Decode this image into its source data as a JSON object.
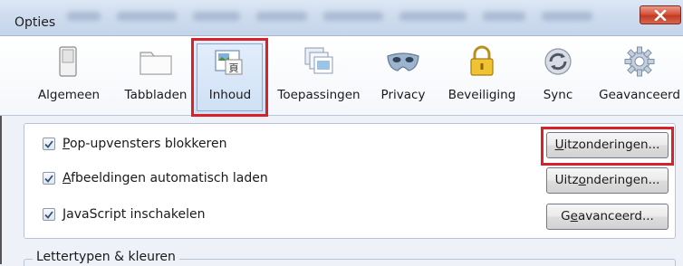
{
  "window": {
    "title": "Opties"
  },
  "tabs": [
    {
      "label": "Algemeen",
      "icon": "switch-icon"
    },
    {
      "label": "Tabbladen",
      "icon": "folder-tabs-icon"
    },
    {
      "label": "Inhoud",
      "icon": "content-page-icon",
      "selected": true
    },
    {
      "label": "Toepassingen",
      "icon": "applications-icon"
    },
    {
      "label": "Privacy",
      "icon": "mask-icon"
    },
    {
      "label": "Beveiliging",
      "icon": "padlock-icon"
    },
    {
      "label": "Sync",
      "icon": "sync-icon"
    },
    {
      "label": "Geavanceerd",
      "icon": "gear-icon"
    }
  ],
  "options": [
    {
      "prefix": "",
      "underline": "P",
      "rest": "op-upvensters blokkeren",
      "checked": true,
      "button": {
        "prefix": "",
        "underline": "U",
        "rest": "itzonderingen..."
      }
    },
    {
      "prefix": "",
      "underline": "A",
      "rest": "fbeeldingen automatisch laden",
      "checked": true,
      "button": {
        "prefix": "Uitz",
        "underline": "o",
        "rest": "nderingen..."
      }
    },
    {
      "prefix": "",
      "underline": "J",
      "rest": "avaScript inschakelen",
      "checked": true,
      "button": {
        "prefix": "G",
        "underline": "e",
        "rest": "avanceerd..."
      }
    }
  ],
  "fonts_section": {
    "legend": "Lettertypen & kleuren"
  },
  "colors": {
    "highlight": "#d8212a",
    "close_button": "#c23a22"
  }
}
